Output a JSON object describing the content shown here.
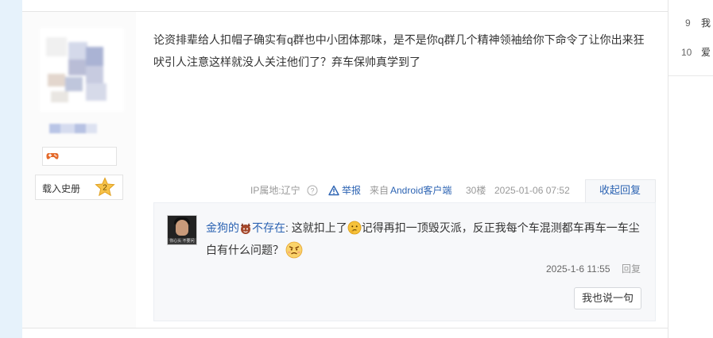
{
  "author": {
    "level_name": "载入史册",
    "level_number": "2"
  },
  "post": {
    "content": "论资排辈给人扣帽子确实有q群也中小团体那味，是不是你q群几个精神领袖给你下命令了让你出来狂吠引人注意这样就没人关注他们了？弃车保帅真学到了",
    "ip_label": "IP属地:辽宁",
    "report_label": "举报",
    "source_prefix": "来自",
    "source_link": "Android客户端",
    "floor": "30楼",
    "date": "2025-01-06 07:52",
    "collapse_label": "收起回复"
  },
  "reply": {
    "author": "金狗的",
    "tail_text": "不存在",
    "colon": ":",
    "text_part1": " 这就扣上了",
    "text_part2": "记得再扣一顶毁灭派，反正我每个车混测都车再车一车尘白有什么问题？",
    "date": "2025-1-6 11:55",
    "reply_label": "回复",
    "say_button": "我也说一句",
    "avatar_caption": "你心头 不要问我"
  },
  "sidebar_ranks": [
    {
      "num": "9",
      "text": "我"
    },
    {
      "num": "10",
      "text": "爱"
    }
  ],
  "colors": {
    "link": "#2d64b3",
    "background_strip": "#e6f2fb",
    "reply_bg": "#f7f8fa"
  },
  "icons": [
    "help-icon",
    "warning-icon",
    "game-controller-icon",
    "star-level-icon",
    "devil-emoji-icon",
    "thinking-emoji-icon",
    "angry-emoji-icon"
  ]
}
